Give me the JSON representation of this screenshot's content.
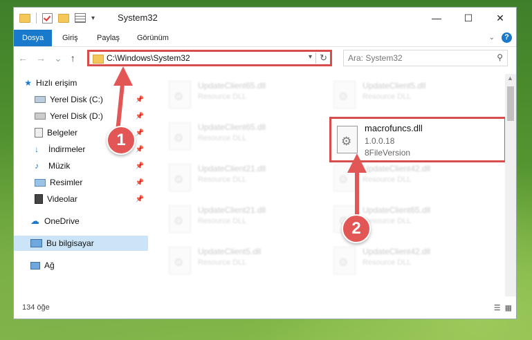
{
  "window": {
    "title": "System32",
    "controls": {
      "minimize": "—",
      "maximize": "☐",
      "close": "✕"
    }
  },
  "ribbon": {
    "tabs": [
      "Dosya",
      "Giriş",
      "Paylaş",
      "Görünüm"
    ],
    "active_tab": "Dosya",
    "help": "?"
  },
  "nav": {
    "back": "←",
    "forward": "→",
    "recent": "⌄",
    "up": "↑"
  },
  "address": {
    "path": "C:\\Windows\\System32"
  },
  "search": {
    "placeholder": "Ara: System32"
  },
  "sidebar": {
    "items": [
      {
        "label": "Hızlı erişim",
        "icon": "star-icon"
      },
      {
        "label": "Yerel Disk (C:)",
        "icon": "drive-icon"
      },
      {
        "label": "Yerel Disk (D:)",
        "icon": "drive-icon"
      },
      {
        "label": "Belgeler",
        "icon": "documents-icon"
      },
      {
        "label": "İndirmeler",
        "icon": "download-icon"
      },
      {
        "label": "Müzik",
        "icon": "music-icon"
      },
      {
        "label": "Resimler",
        "icon": "pictures-icon"
      },
      {
        "label": "Videolar",
        "icon": "video-icon"
      },
      {
        "label": "OneDrive",
        "icon": "cloud-icon"
      },
      {
        "label": "Bu bilgisayar",
        "icon": "computer-icon"
      },
      {
        "label": "Ağ",
        "icon": "network-icon"
      }
    ]
  },
  "files": [
    {
      "name": "UpdateClient65.dll",
      "desc": "Resource DLL"
    },
    {
      "name": "UpdateClient5.dll",
      "desc": "Resource DLL"
    },
    {
      "name": "UpdateClient65.dll",
      "desc": "Resource DLL"
    },
    {
      "name": "UpdateClient21.dll",
      "desc": "Resource DLL"
    },
    {
      "name": "UpdateClient42.dll",
      "desc": "Resource DLL"
    },
    {
      "name": "UpdateClient21.dll",
      "desc": "Resource DLL"
    },
    {
      "name": "UpdateClient65.dll",
      "desc": "Resource DLL"
    },
    {
      "name": "UpdateClient5.dll",
      "desc": "Resource DLL"
    },
    {
      "name": "UpdateClient42.dll",
      "desc": "Resource DLL"
    }
  ],
  "highlighted_file": {
    "name": "macrofuncs.dll",
    "version": "1.0.0.18",
    "type": "8FileVersion"
  },
  "annotations": {
    "step1": "1",
    "step2": "2",
    "color": "#e35656"
  },
  "status": {
    "count": "134 öğe"
  }
}
